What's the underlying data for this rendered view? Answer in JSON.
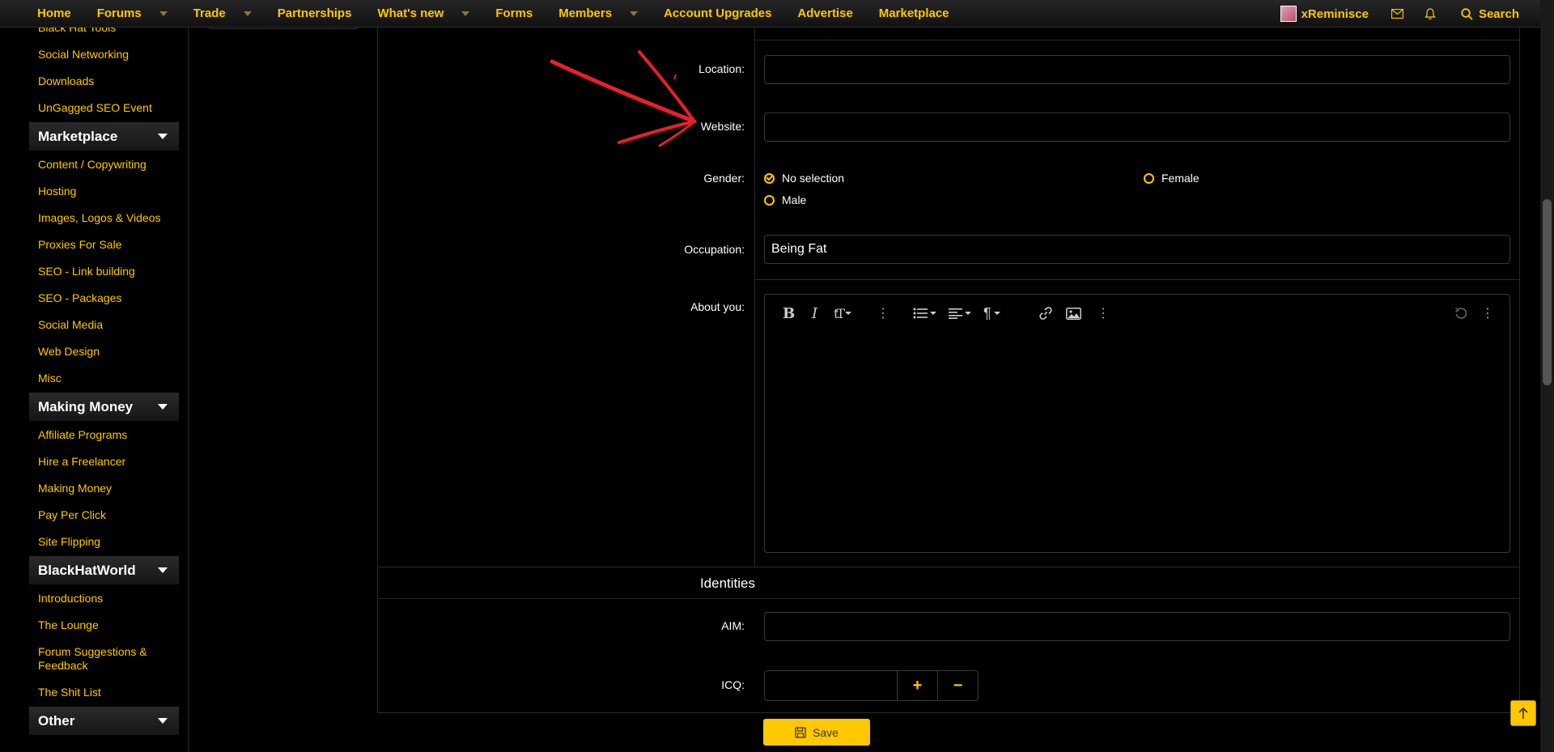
{
  "nav": {
    "items": [
      {
        "label": "Home",
        "caret": false
      },
      {
        "label": "Forums",
        "caret": true
      },
      {
        "label": "Trade",
        "caret": true
      },
      {
        "label": "Partnerships",
        "caret": false
      },
      {
        "label": "What's new",
        "caret": true
      },
      {
        "label": "Forms",
        "caret": false
      },
      {
        "label": "Members",
        "caret": true
      },
      {
        "label": "Account Upgrades",
        "caret": false
      },
      {
        "label": "Advertise",
        "caret": false
      },
      {
        "label": "Marketplace",
        "caret": false
      }
    ],
    "username": "xReminisce",
    "search_label": "Search"
  },
  "sidebar": {
    "top_links": [
      "Black Hat Tools",
      "Social Networking",
      "Downloads",
      "UnGagged SEO Event"
    ],
    "sections": [
      {
        "title": "Marketplace",
        "links": [
          "Content / Copywriting",
          "Hosting",
          "Images, Logos & Videos",
          "Proxies For Sale",
          "SEO - Link building",
          "SEO - Packages",
          "Social Media",
          "Web Design",
          "Misc"
        ]
      },
      {
        "title": "Making Money",
        "links": [
          "Affiliate Programs",
          "Hire a Freelancer",
          "Making Money",
          "Pay Per Click",
          "Site Flipping"
        ]
      },
      {
        "title": "BlackHatWorld",
        "links": [
          "Introductions",
          "The Lounge",
          "Forum Suggestions & Feedback",
          "The Shit List"
        ]
      },
      {
        "title": "Other",
        "links": []
      }
    ]
  },
  "form": {
    "location_label": "Location:",
    "location_value": "",
    "website_label": "Website:",
    "website_value": "",
    "gender_label": "Gender:",
    "gender_options": [
      {
        "label": "No selection",
        "checked": true
      },
      {
        "label": "Female",
        "checked": false
      },
      {
        "label": "Male",
        "checked": false
      }
    ],
    "occupation_label": "Occupation:",
    "occupation_value": "Being Fat",
    "about_label": "About you:",
    "identities_title": "Identities",
    "aim_label": "AIM:",
    "aim_value": "",
    "icq_label": "ICQ:",
    "icq_plus": "+",
    "icq_minus": "−",
    "save_label": "Save"
  },
  "colors": {
    "accent": "#ffc800",
    "annotation": "#e8202a"
  }
}
